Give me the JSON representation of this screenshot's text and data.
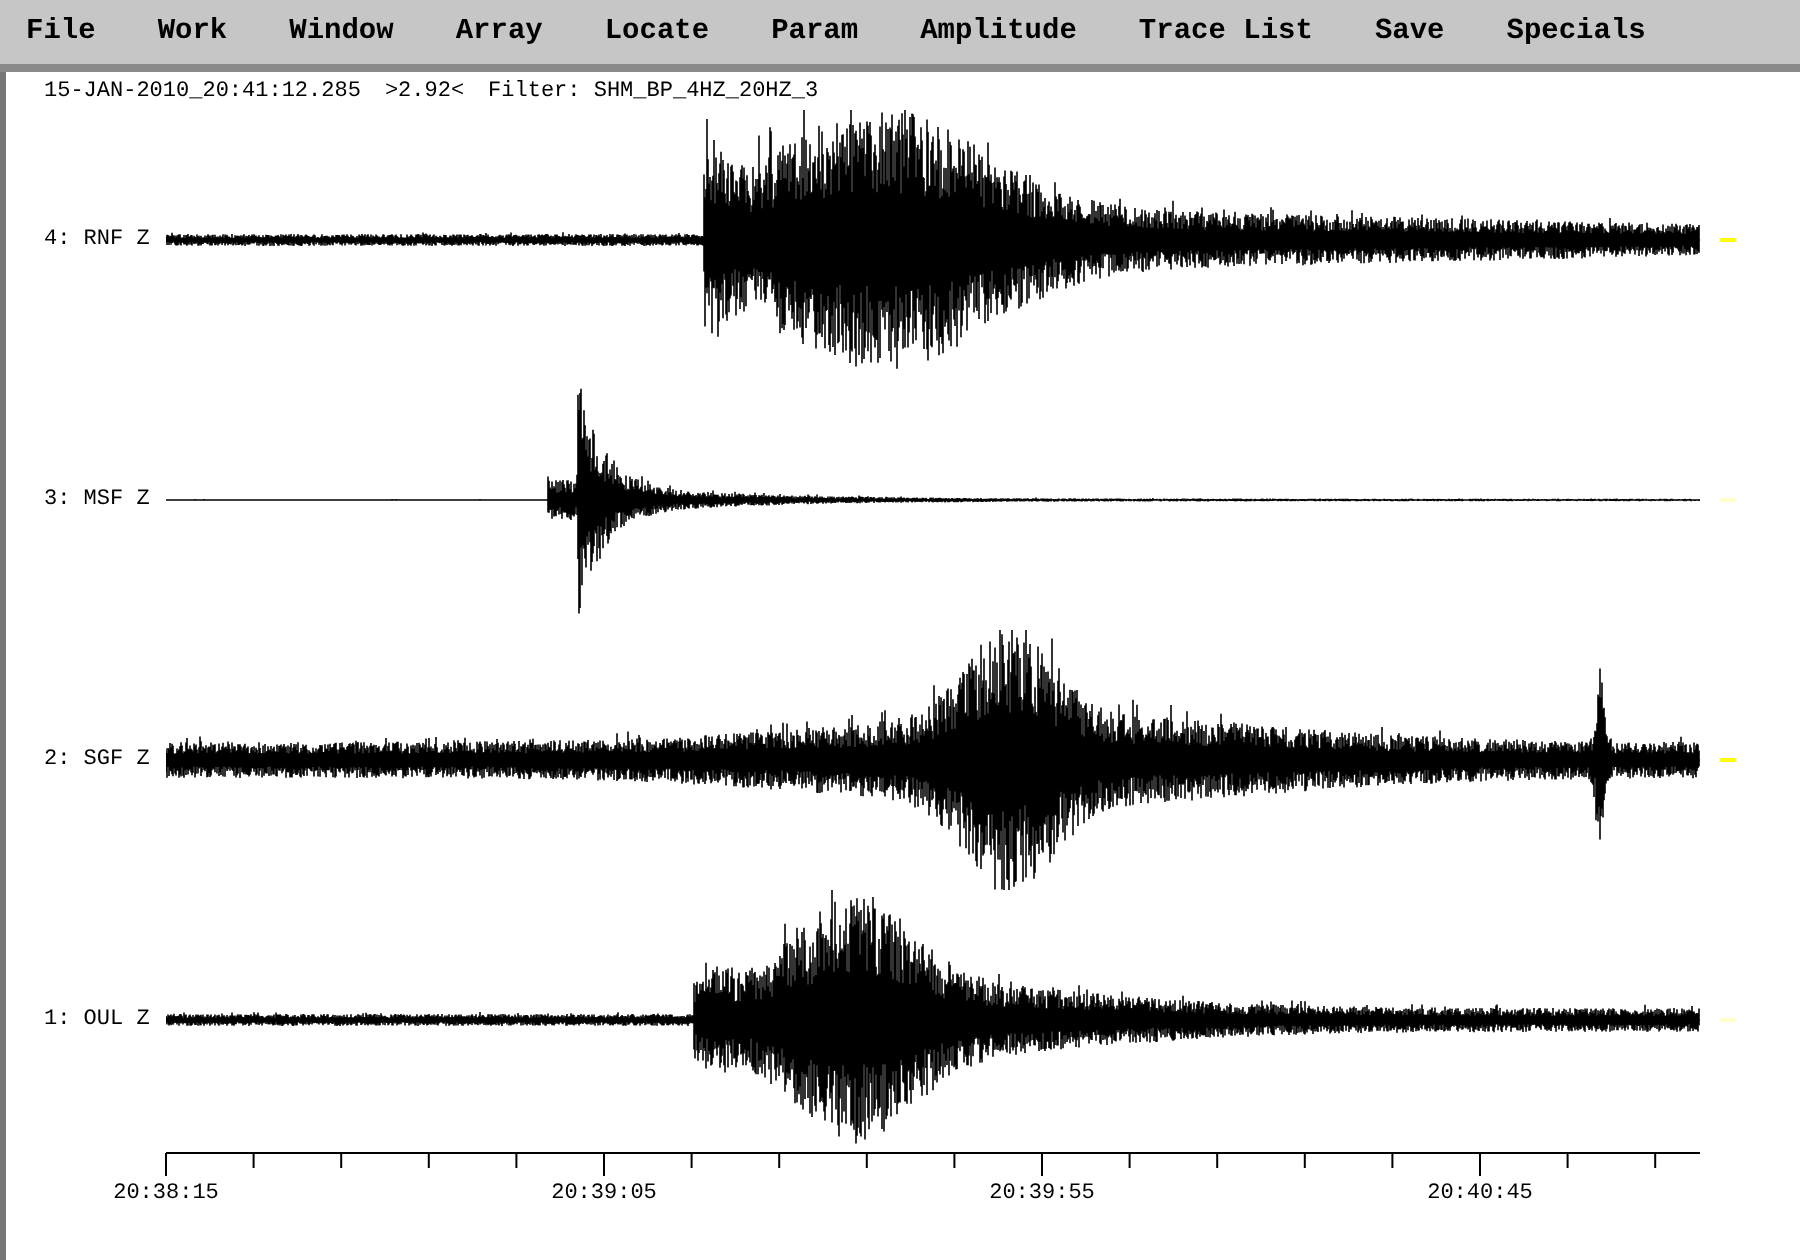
{
  "menu": [
    "File",
    "Work",
    "Window",
    "Array",
    "Locate",
    "Param",
    "Amplitude",
    "Trace List",
    "Save",
    "Specials"
  ],
  "header": {
    "timestamp": "15-JAN-2010_20:41:12.285",
    "value": ">2.92<",
    "filter": "Filter: SHM_BP_4HZ_20HZ_3"
  },
  "traces": [
    {
      "label": "4: RNF Z",
      "color": "#ffff00"
    },
    {
      "label": "3: MSF Z",
      "color": "#ffffc8"
    },
    {
      "label": "2: SGF Z",
      "color": "#ffff00"
    },
    {
      "label": "1: OUL Z",
      "color": "#ffffc8"
    }
  ],
  "time_axis": {
    "labels": [
      "20:38:15",
      "20:39:05",
      "20:39:55",
      "20:40:45"
    ]
  }
}
